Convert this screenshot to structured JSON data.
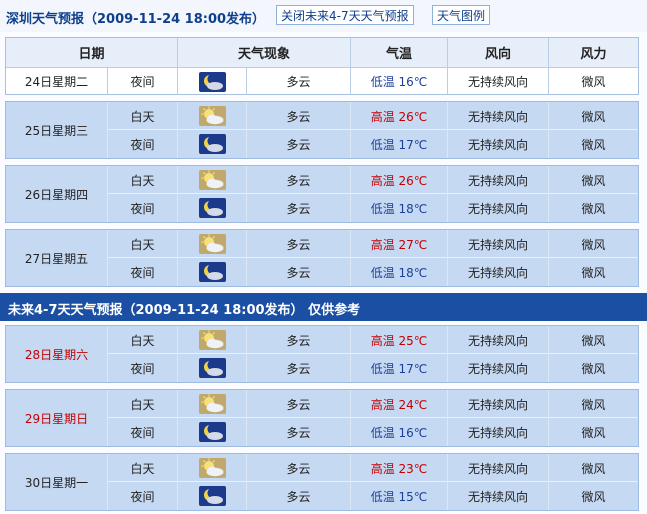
{
  "title": "深圳天气预报（2009-11-24 18:00发布）",
  "buttons": {
    "close_forecast": "关闭未来4-7天天气预报",
    "legend": "天气图例"
  },
  "headers": {
    "date": "日期",
    "phenomenon": "天气现象",
    "temperature": "气温",
    "wind_direction": "风向",
    "wind_force": "风力"
  },
  "current": {
    "date": "24日星期二",
    "period": "夜间",
    "icon": "cloudy-night-icon",
    "weather": "多云",
    "temp": "低温 16℃",
    "wind_dir": "无持续风向",
    "wind_force": "微风"
  },
  "banner": "未来4-7天天气预报（2009-11-24 18:00发布）  仅供参考",
  "days": [
    {
      "date": "25日星期三",
      "weekend": false,
      "day": {
        "period": "白天",
        "icon": "partly-cloudy-day-icon",
        "weather": "多云",
        "temp": "高温 26℃",
        "wind_dir": "无持续风向",
        "wind_force": "微风"
      },
      "night": {
        "period": "夜间",
        "icon": "cloudy-night-icon",
        "weather": "多云",
        "temp": "低温 17℃",
        "wind_dir": "无持续风向",
        "wind_force": "微风"
      }
    },
    {
      "date": "26日星期四",
      "weekend": false,
      "day": {
        "period": "白天",
        "icon": "partly-cloudy-day-icon",
        "weather": "多云",
        "temp": "高温 26℃",
        "wind_dir": "无持续风向",
        "wind_force": "微风"
      },
      "night": {
        "period": "夜间",
        "icon": "cloudy-night-icon",
        "weather": "多云",
        "temp": "低温 18℃",
        "wind_dir": "无持续风向",
        "wind_force": "微风"
      }
    },
    {
      "date": "27日星期五",
      "weekend": false,
      "day": {
        "period": "白天",
        "icon": "partly-cloudy-day-icon",
        "weather": "多云",
        "temp": "高温 27℃",
        "wind_dir": "无持续风向",
        "wind_force": "微风"
      },
      "night": {
        "period": "夜间",
        "icon": "cloudy-night-icon",
        "weather": "多云",
        "temp": "低温 18℃",
        "wind_dir": "无持续风向",
        "wind_force": "微风"
      }
    },
    {
      "date": "28日星期六",
      "weekend": true,
      "day": {
        "period": "白天",
        "icon": "partly-cloudy-day-icon",
        "weather": "多云",
        "temp": "高温 25℃",
        "wind_dir": "无持续风向",
        "wind_force": "微风"
      },
      "night": {
        "period": "夜间",
        "icon": "cloudy-night-icon",
        "weather": "多云",
        "temp": "低温 17℃",
        "wind_dir": "无持续风向",
        "wind_force": "微风"
      }
    },
    {
      "date": "29日星期日",
      "weekend": true,
      "day": {
        "period": "白天",
        "icon": "partly-cloudy-day-icon",
        "weather": "多云",
        "temp": "高温 24℃",
        "wind_dir": "无持续风向",
        "wind_force": "微风"
      },
      "night": {
        "period": "夜间",
        "icon": "cloudy-night-icon",
        "weather": "多云",
        "temp": "低温 16℃",
        "wind_dir": "无持续风向",
        "wind_force": "微风"
      }
    },
    {
      "date": "30日星期一",
      "weekend": false,
      "day": {
        "period": "白天",
        "icon": "partly-cloudy-day-icon",
        "weather": "多云",
        "temp": "高温 23℃",
        "wind_dir": "无持续风向",
        "wind_force": "微风"
      },
      "night": {
        "period": "夜间",
        "icon": "cloudy-night-icon",
        "weather": "多云",
        "temp": "低温 15℃",
        "wind_dir": "无持续风向",
        "wind_force": "微风"
      }
    }
  ],
  "colors": {
    "banner": "#1a4fa3",
    "row_bg": "#c6d9f2",
    "high_temp": "#c30000",
    "low_temp": "#1b3f9a",
    "weekend_date": "#c30000"
  }
}
